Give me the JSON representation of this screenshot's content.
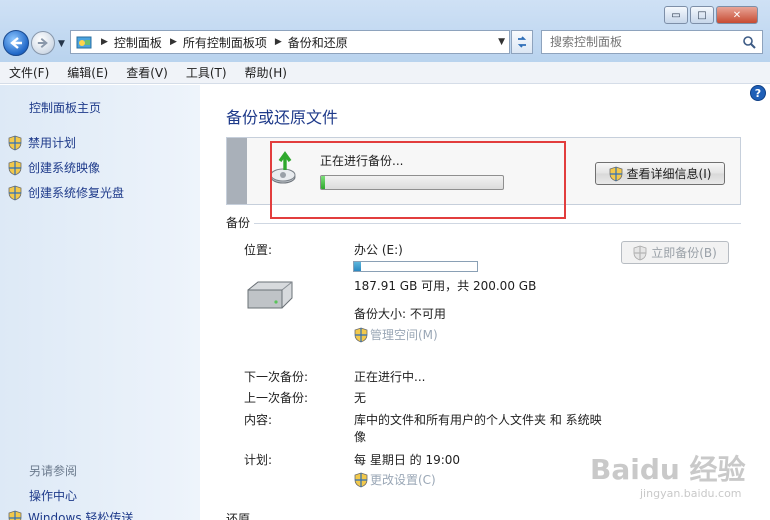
{
  "window": {
    "minimize_label": "▭",
    "maximize_label": "□",
    "close_label": "✕"
  },
  "address": {
    "crumbs": [
      "控制面板",
      "所有控制面板项",
      "备份和还原"
    ]
  },
  "search": {
    "placeholder": "搜索控制面板"
  },
  "menu": [
    "文件(F)",
    "编辑(E)",
    "查看(V)",
    "工具(T)",
    "帮助(H)"
  ],
  "sidebar": {
    "home": "控制面板主页",
    "items": [
      {
        "label": "禁用计划",
        "icon": "shield-icon"
      },
      {
        "label": "创建系统映像",
        "icon": "shield-icon"
      },
      {
        "label": "创建系统修复光盘",
        "icon": "shield-icon"
      }
    ],
    "see_also_title": "另请参阅",
    "see_also": [
      "操作中心",
      "Windows 轻松传送"
    ]
  },
  "main": {
    "title": "备份或还原文件",
    "progress": {
      "label": "正在进行备份...",
      "fraction": 0.02
    },
    "details_button": "查看详细信息(I)",
    "backup_section": "备份",
    "location_key": "位置:",
    "location_value": "办公 (E:)",
    "space_fraction": 0.06,
    "space_text": "187.91 GB 可用，共 200.00 GB",
    "backup_size": "备份大小: 不可用",
    "manage_space": "管理空间(M)",
    "backup_now": "立即备份(B)",
    "next_key": "下一次备份:",
    "next_value": "正在进行中...",
    "last_key": "上一次备份:",
    "last_value": "无",
    "content_key": "内容:",
    "content_value_1": "库中的文件和所有用户的个人文件夹 和 系统映",
    "content_value_2": "像",
    "schedule_key": "计划:",
    "schedule_value": "每 星期日 的 19:00",
    "change_settings": "更改设置(C)",
    "restore_section": "还原"
  },
  "watermark": {
    "text": "Baidu 经验",
    "sub": "jingyan.baidu.com"
  },
  "colors": {
    "accent": "#1e3a8a",
    "highlight": "#e23d3d",
    "progress": "#2fa82d"
  }
}
